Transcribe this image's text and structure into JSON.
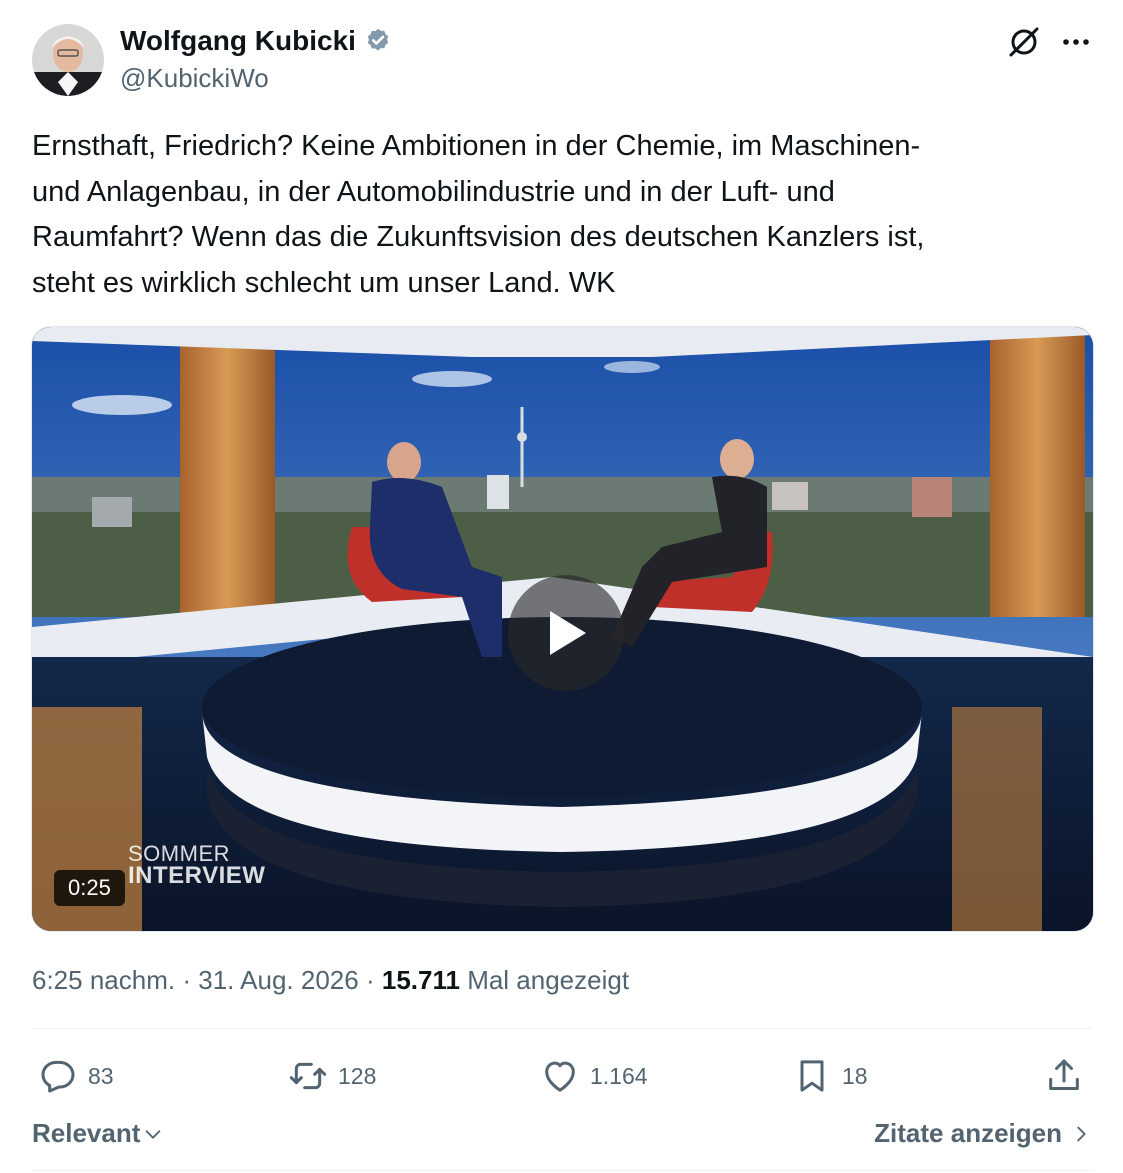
{
  "author": {
    "name": "Wolfgang Kubicki",
    "handle": "@KubickiWo",
    "verified": true
  },
  "tweet": {
    "text": "Ernsthaft, Friedrich? Keine Ambitionen in der Chemie, im Maschinen-\nund Anlagenbau, in der Automobilindustrie und in der Luft- und\nRaumfahrt? Wenn das die Zukunftsvision des deutschen Kanzlers ist,\nsteht es wirklich schlecht um unser Land. WK"
  },
  "media": {
    "duration": "0:25",
    "logo_line1": "SOMMER",
    "logo_line2": "INTERVIEW"
  },
  "meta": {
    "time": "6:25 nachm.",
    "separator": "·",
    "date": "31. Aug. 2026",
    "views_count": "15.711",
    "views_label": "Mal angezeigt"
  },
  "actions": {
    "replies": "83",
    "reposts": "128",
    "likes": "1.164",
    "bookmarks": "18"
  },
  "sort": {
    "label": "Relevant",
    "quotes_link": "Zitate anzeigen"
  },
  "icons": {
    "verified": "verified-badge-icon",
    "grok": "grok-icon",
    "more": "more-dots-icon",
    "reply": "reply-icon",
    "repost": "repost-icon",
    "like": "heart-icon",
    "bookmark": "bookmark-icon",
    "share": "share-icon",
    "play": "play-icon"
  },
  "colors": {
    "text_primary": "#0f1419",
    "text_secondary": "#536471",
    "divider": "#eff3f4"
  }
}
